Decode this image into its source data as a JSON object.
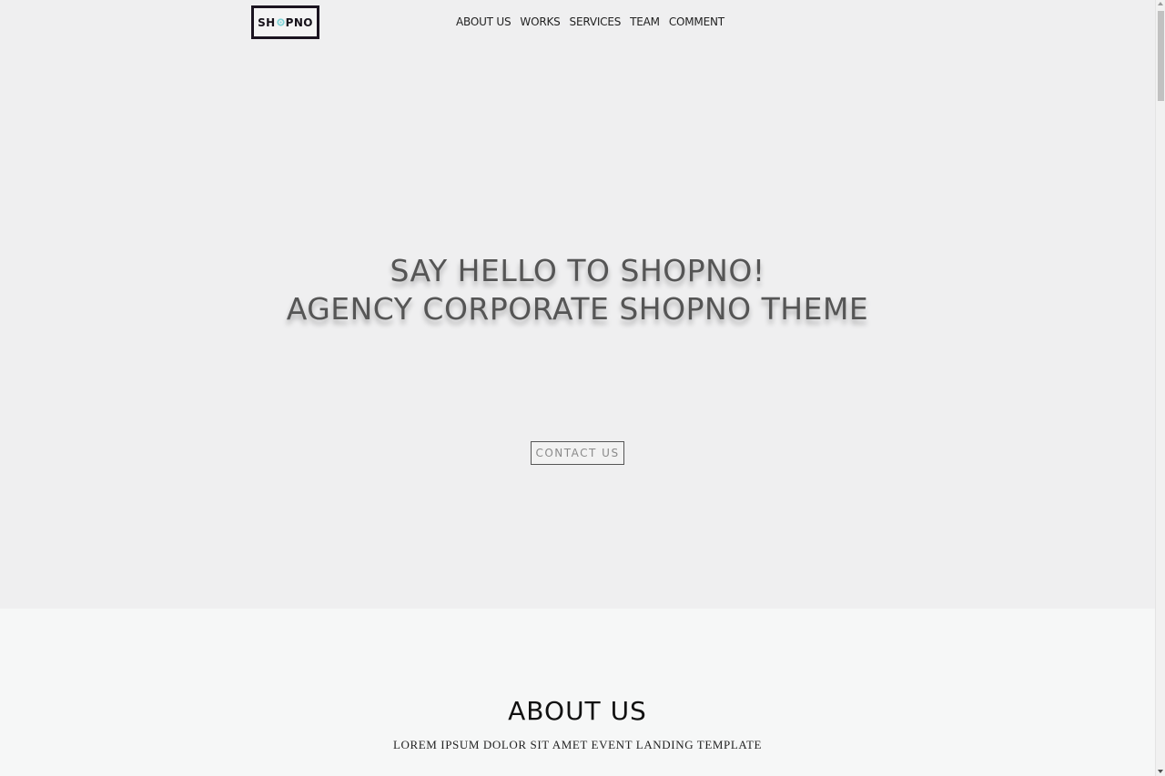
{
  "header": {
    "logo": {
      "text_before": "SH",
      "text_after": "PNO",
      "accent_color": "#7fd3d6",
      "border_color": "#1b1420",
      "icon": "gear-o-icon"
    },
    "nav": [
      {
        "label": "ABOUT US"
      },
      {
        "label": "WORKS"
      },
      {
        "label": "SERVICES"
      },
      {
        "label": "TEAM"
      },
      {
        "label": "COMMENT"
      }
    ]
  },
  "hero": {
    "title_line1": "SAY HELLO TO SHOPNO!",
    "title_line2": "AGENCY CORPORATE SHOPNO THEME",
    "cta_label": "CONTACT US",
    "background": "#efeff0"
  },
  "about": {
    "title": "ABOUT US",
    "subtitle": "LOREM IPSUM DOLOR SIT AMET EVENT LANDING TEMPLATE",
    "background": "#f6f7f7"
  }
}
